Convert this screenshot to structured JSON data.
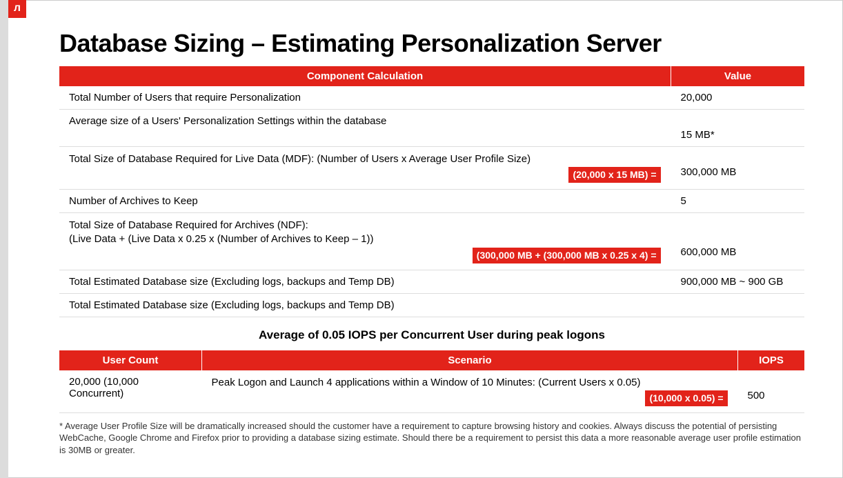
{
  "logo": "л",
  "title": "Database Sizing – Estimating Personalization Server",
  "table1": {
    "headers": {
      "component": "Component Calculation",
      "value": "Value"
    },
    "rows": [
      {
        "component_text": "Total Number of Users that require Personalization",
        "highlight": "",
        "value": "20,000"
      },
      {
        "component_text": "Average size of a Users' Personalization Settings within the database",
        "highlight": "",
        "value": "15 MB*"
      },
      {
        "component_text": "Total Size of Database Required for Live Data (MDF): (Number of Users x Average User Profile Size)",
        "highlight": "(20,000 x 15 MB) =",
        "value": "300,000 MB"
      },
      {
        "component_text": "Number of Archives to Keep",
        "highlight": "",
        "value": "5"
      },
      {
        "component_text": "Total Size of Database Required for Archives (NDF):\n(Live Data + (Live Data x 0.25 x (Number of Archives to Keep – 1))",
        "highlight": "(300,000 MB + (300,000 MB x 0.25 x 4) =",
        "value": "600,000 MB"
      },
      {
        "component_text": "Total Estimated Database size (Excluding logs, backups and Temp DB)",
        "highlight": "",
        "value": "900,000 MB ~ 900 GB"
      },
      {
        "component_text": "Total Estimated Database size (Excluding logs, backups and Temp DB)",
        "highlight": "",
        "value": ""
      }
    ]
  },
  "middle_caption": "Average of 0.05 IOPS per Concurrent User during peak logons",
  "table2": {
    "headers": {
      "user_count": "User Count",
      "scenario": "Scenario",
      "iops": "IOPS"
    },
    "row": {
      "user_count": "20,000 (10,000 Concurrent)",
      "scenario_text": "Peak Logon and Launch 4 applications within a Window of 10 Minutes: (Current Users x 0.05)",
      "highlight": "(10,000 x 0.05) =",
      "iops": "500"
    }
  },
  "footnote": "* Average User Profile Size will be dramatically increased should the customer have a requirement to capture browsing history and cookies. Always discuss the potential of persisting WebCache, Google Chrome and Firefox prior to providing a database sizing estimate. Should there be a requirement to persist this data a more reasonable average user profile estimation is 30MB or greater."
}
